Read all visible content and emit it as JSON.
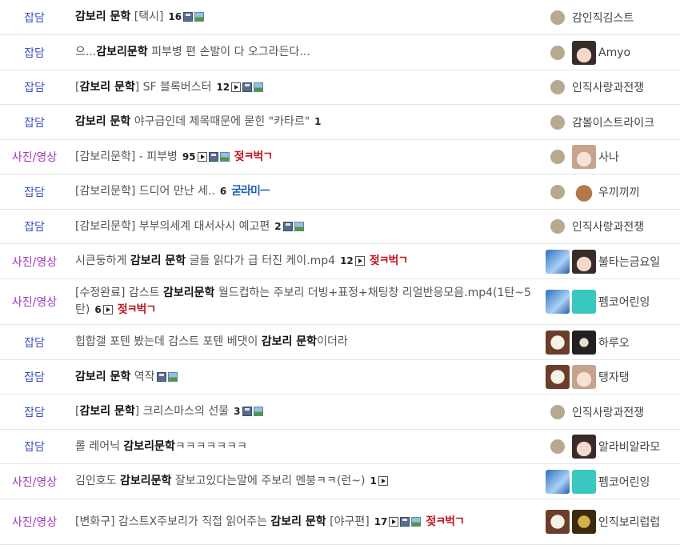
{
  "rows": [
    {
      "cat": "잡담",
      "catColor": "blue",
      "prefix": "",
      "kw": "감보리 문학",
      "suffix": " [택시]",
      "count": "16",
      "icons": [
        "disk",
        "pic"
      ],
      "badge": "",
      "badgeColor": "",
      "authorIcons": [
        "dot"
      ],
      "author": "감인직김스트",
      "h": 44
    },
    {
      "cat": "잡담",
      "catColor": "blue",
      "prefix": "으...",
      "kw": "감보리문학",
      "suffix": " 피부병 편 손발이 다 오그라든다...",
      "count": "",
      "icons": [],
      "badge": "",
      "badgeColor": "",
      "authorIcons": [
        "dot",
        "av-girl1"
      ],
      "author": "Amyo",
      "h": 44
    },
    {
      "cat": "잡담",
      "catColor": "blue",
      "prefix": "[",
      "kw": "감보리 문학",
      "suffix": "] SF 블록버스터",
      "count": "12",
      "icons": [
        "play",
        "disk",
        "pic"
      ],
      "badge": "",
      "badgeColor": "",
      "authorIcons": [
        "dot"
      ],
      "author": "인직사랑과전쟁",
      "h": 43
    },
    {
      "cat": "잡담",
      "catColor": "blue",
      "prefix": "",
      "kw": "감보리 문학",
      "suffix": " 야구급인데 제목때문에 묻힌 \"카타르\"",
      "count": "1",
      "icons": [],
      "badge": "",
      "badgeColor": "",
      "authorIcons": [
        "dot"
      ],
      "author": "감볼이스트라이크",
      "h": 44
    },
    {
      "cat": "사진/영상",
      "catColor": "purple",
      "prefix": "[감보리문학] - 피부병",
      "kw": "",
      "suffix": "",
      "count": "95",
      "icons": [
        "play",
        "disk",
        "pic"
      ],
      "badge": "젖ㅋ벅ㄱ",
      "badgeColor": "red",
      "authorIcons": [
        "dot",
        "av-girl2"
      ],
      "author": "사나",
      "h": 43
    },
    {
      "cat": "잡담",
      "catColor": "blue",
      "prefix": "[감보리문학] 드디어 만난 세..",
      "kw": "",
      "suffix": "",
      "count": "6",
      "icons": [],
      "badge": "굳라미ㅡ",
      "badgeColor": "blue",
      "authorIcons": [
        "dot",
        "av-monkey"
      ],
      "author": "우끼끼끼",
      "h": 44
    },
    {
      "cat": "잡담",
      "catColor": "blue",
      "prefix": "[감보리문학] 부부의세계 대서사시 예고편",
      "kw": "",
      "suffix": "",
      "count": "2",
      "icons": [
        "disk",
        "pic"
      ],
      "badge": "",
      "badgeColor": "",
      "authorIcons": [
        "dot"
      ],
      "author": "인직사랑과전쟁",
      "h": 43
    },
    {
      "cat": "사진/영상",
      "catColor": "purple",
      "prefix": "시큰둥하게 ",
      "kw": "감보리 문학",
      "suffix": " 글들 읽다가 급 터진 케이.mp4",
      "count": "12",
      "icons": [
        "play"
      ],
      "badge": "젖ㅋ벅ㄱ",
      "badgeColor": "red",
      "authorIcons": [
        "av-blue",
        "av-girl1"
      ],
      "author": "불타는금요일",
      "h": 44
    },
    {
      "cat": "사진/영상",
      "catColor": "purple",
      "prefix": "[수정완료] 감스트 ",
      "kw": "감보리문학",
      "suffix": " 월드컵하는 주보리 더빙+표정+채팅창 리얼반응모음.mp4(1탄~5탄)",
      "count": "6",
      "icons": [
        "play"
      ],
      "badge": "젖ㅋ벅ㄱ",
      "badgeColor": "red",
      "authorIcons": [
        "av-blue",
        "av-teal"
      ],
      "author": "펨코어린잉",
      "h": 57
    },
    {
      "cat": "잡담",
      "catColor": "blue",
      "prefix": "힙합갤 포텐 봤는데 감스트 포텐 베댓이 ",
      "kw": "감보리 문학",
      "suffix": "이더라",
      "count": "",
      "icons": [],
      "badge": "",
      "badgeColor": "",
      "authorIcons": [
        "av-dog",
        "av-dark"
      ],
      "author": "하루오",
      "h": 44
    },
    {
      "cat": "잡담",
      "catColor": "blue",
      "prefix": "",
      "kw": "감보리 문학",
      "suffix": " 역작",
      "count": "",
      "icons": [
        "disk",
        "pic"
      ],
      "badge": "",
      "badgeColor": "",
      "authorIcons": [
        "av-dog",
        "av-girl2"
      ],
      "author": "탱자탱",
      "h": 43
    },
    {
      "cat": "잡담",
      "catColor": "blue",
      "prefix": "[",
      "kw": "감보리 문학",
      "suffix": "] 크리스마스의 선물",
      "count": "3",
      "icons": [
        "disk",
        "pic"
      ],
      "badge": "",
      "badgeColor": "",
      "authorIcons": [
        "dot"
      ],
      "author": "인직사랑과전쟁",
      "h": 44
    },
    {
      "cat": "잡담",
      "catColor": "blue",
      "prefix": "롤 레어닉 ",
      "kw": "감보리문학",
      "suffix": "ㅋㅋㅋㅋㅋㅋㅋ",
      "count": "",
      "icons": [],
      "badge": "",
      "badgeColor": "",
      "authorIcons": [
        "dot",
        "av-girl1"
      ],
      "author": "알라비알라모",
      "h": 43
    },
    {
      "cat": "사진/영상",
      "catColor": "purple",
      "prefix": "김인호도 ",
      "kw": "감보리문학",
      "suffix": " 잘보고있다는말에 주보리 멘붕ㅋㅋ(런~)",
      "count": "1",
      "icons": [
        "play"
      ],
      "badge": "",
      "badgeColor": "",
      "authorIcons": [
        "av-blue",
        "av-teal"
      ],
      "author": "펨코어린잉",
      "h": 44
    },
    {
      "cat": "사진/영상",
      "catColor": "purple",
      "prefix": "[변화구] 감스트X주보리가 직접 읽어주는 ",
      "kw": "감보리 문학",
      "suffix": " [야구편]",
      "count": "17",
      "icons": [
        "play",
        "disk",
        "pic"
      ],
      "badge": "젖ㅋ벅ㄱ",
      "badgeColor": "red",
      "authorIcons": [
        "av-dog",
        "av-gold"
      ],
      "author": "인직보리럽럽",
      "h": 57
    }
  ]
}
